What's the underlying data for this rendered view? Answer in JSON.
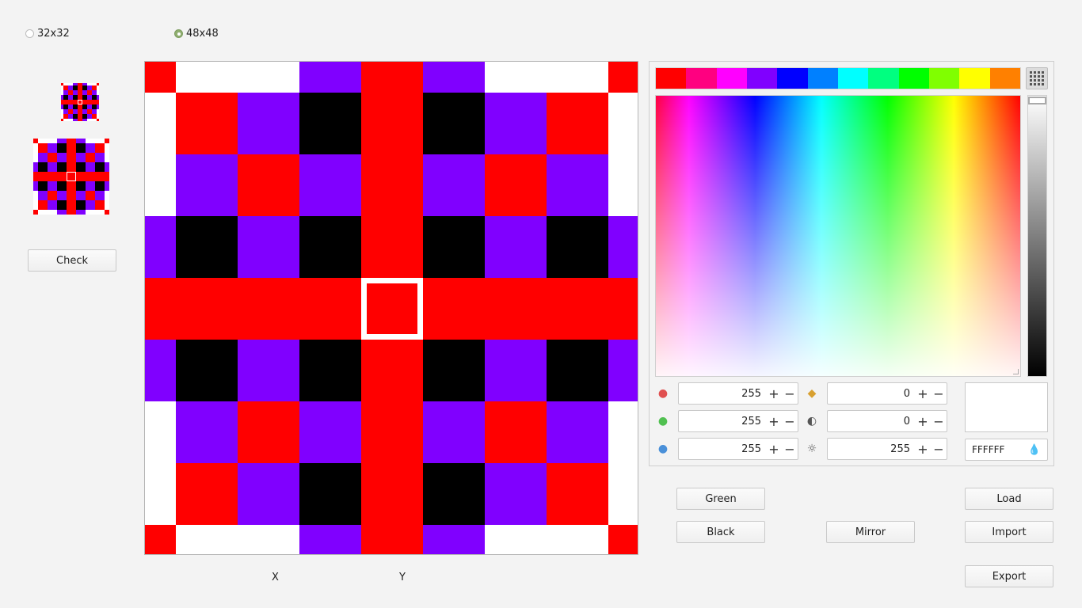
{
  "size_options": [
    {
      "label": "32x32",
      "checked": false
    },
    {
      "label": "48x48",
      "checked": true
    }
  ],
  "buttons": {
    "check": "Check",
    "green": "Green",
    "black": "Black",
    "mirror": "Mirror",
    "load": "Load",
    "import": "Import",
    "export": "Export"
  },
  "axes": {
    "x": "X",
    "y": "Y"
  },
  "palette": {
    "swatches": [
      "#ff0000",
      "#ff0080",
      "#ff00ff",
      "#8000ff",
      "#0000ff",
      "#0080ff",
      "#00ffff",
      "#00ff80",
      "#00ff00",
      "#80ff00",
      "#ffff00",
      "#ff8000"
    ],
    "red": "255",
    "green": "255",
    "blue": "255",
    "hue": "0",
    "saturation": "0",
    "value": "255",
    "hex": "FFFFFF",
    "current_color": "#ffffff"
  },
  "pattern_colors": {
    "R": "#ff0000",
    "P": "#8000ff",
    "K": "#000000",
    "W": "#ffffff"
  }
}
